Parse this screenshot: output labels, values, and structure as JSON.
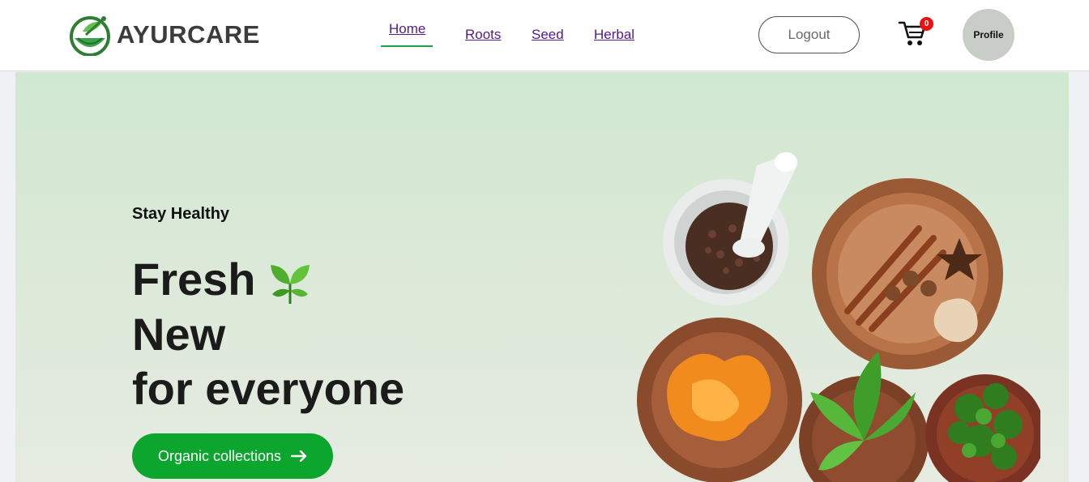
{
  "brand": {
    "name": "AYURCARE"
  },
  "nav": {
    "items": [
      {
        "label": "Home",
        "active": true
      },
      {
        "label": "Roots"
      },
      {
        "label": "Seed"
      },
      {
        "label": "Herbal"
      }
    ]
  },
  "header": {
    "logout_label": "Logout",
    "cart_count": "0",
    "profile_label": "Profile"
  },
  "hero": {
    "tagline": "Stay Healthy",
    "headline_lines": [
      "Fresh",
      "New",
      "for everyone"
    ],
    "cta_label": "Organic collections",
    "images": [
      "mortar-cloves",
      "bowl-cinnamon-spices",
      "bowl-orange-peel",
      "bowl-green-leaves",
      "bowl-herbs"
    ]
  },
  "colors": {
    "accent_green": "#0ca52e",
    "nav_link": "#551a8b",
    "hero_bg": "#d0e8d0",
    "badge_red": "#ee1111"
  }
}
